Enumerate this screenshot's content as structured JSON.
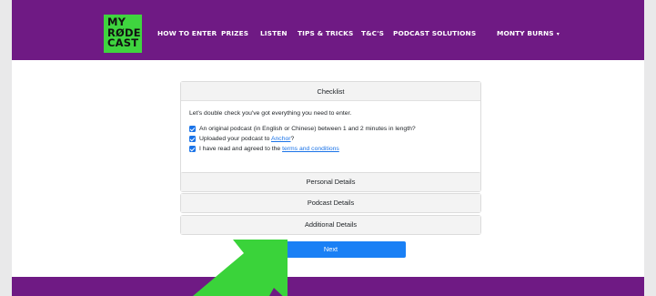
{
  "brand": {
    "logo_lines": [
      "MY",
      "RØDE",
      "CAST"
    ]
  },
  "nav": {
    "items": [
      "HOW TO ENTER",
      "PRIZES",
      "LISTEN",
      "TIPS & TRICKS",
      "T&C'S",
      "PODCAST SOLUTIONS"
    ],
    "user": "MONTY BURNS"
  },
  "checklist": {
    "title": "Checklist",
    "intro": "Let's double check you've got everything you need to enter.",
    "items": [
      {
        "text": "An original podcast (in English or Chinese) between 1 and 2 minutes in length?",
        "checked": true
      },
      {
        "pre": "Uploaded your podcast to ",
        "link": "Anchor",
        "post": "?",
        "checked": true
      },
      {
        "pre": "I have read and agreed to the ",
        "link": "terms and conditions",
        "post": "",
        "checked": true
      }
    ]
  },
  "sections": [
    "Personal Details",
    "Podcast Details",
    "Additional Details"
  ],
  "next_button": "Next",
  "colors": {
    "nav": "#6f1a84",
    "logo": "#3fd43f",
    "primary": "#1a80f5",
    "arrow": "#3ad33a"
  },
  "icons": {
    "caret": "caret-down-icon",
    "check": "checkbox-checked-icon",
    "pointer": "arrow-pointer-icon"
  }
}
